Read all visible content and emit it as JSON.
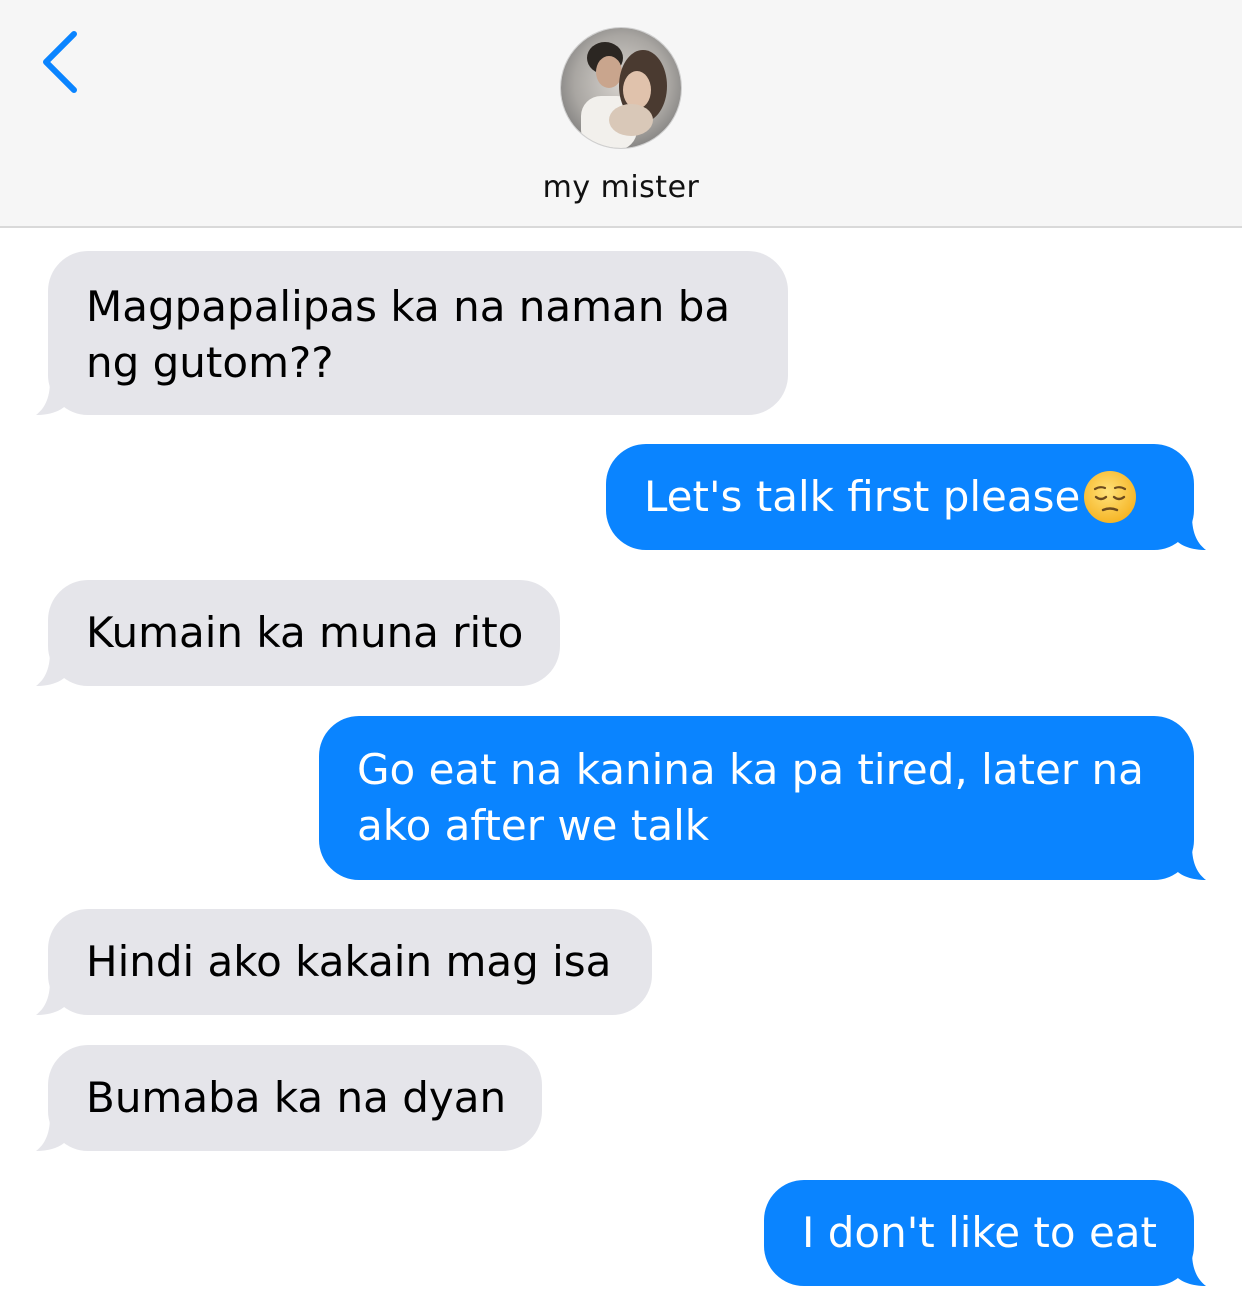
{
  "header": {
    "contact_name": "my mister",
    "back_icon": "chevron-left-icon",
    "accent_color": "#0a84ff"
  },
  "messages": [
    {
      "side": "incoming",
      "lines": [
        "Magpapalipas ka na naman ba",
        "ng gutom??"
      ]
    },
    {
      "side": "outgoing",
      "lines": [
        "Let's talk first please"
      ],
      "emoji": "pensive-face-emoji"
    },
    {
      "side": "incoming",
      "lines": [
        "Kumain ka muna rito"
      ]
    },
    {
      "side": "outgoing",
      "lines": [
        "Go eat na kanina ka pa tired, later na",
        "ako after we talk"
      ]
    },
    {
      "side": "incoming",
      "lines": [
        "Hindi ako kakain mag isa"
      ]
    },
    {
      "side": "incoming",
      "lines": [
        "Bumaba ka na dyan"
      ]
    },
    {
      "side": "outgoing",
      "lines": [
        "I don't like to eat"
      ]
    }
  ],
  "colors": {
    "incoming_bubble": "#e5e5ea",
    "outgoing_bubble": "#0a84ff",
    "header_bg": "#f6f6f6"
  }
}
